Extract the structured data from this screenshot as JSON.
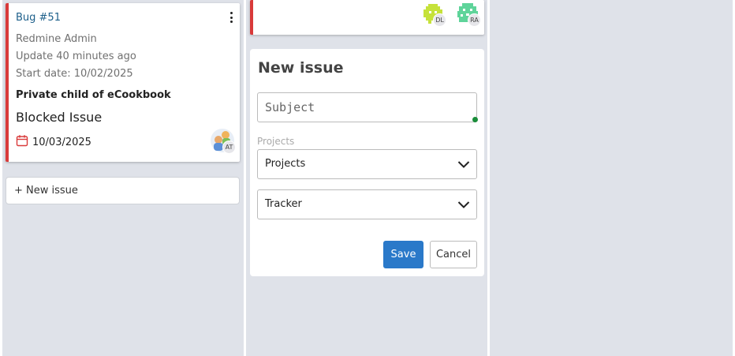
{
  "issue_card": {
    "title": "Bug #51",
    "author": "Redmine Admin",
    "updated": "Update 40 minutes ago",
    "start_date": "Start date: 10/02/2025",
    "project": "Private child of eCookbook",
    "subject": "Blocked Issue",
    "due_date": "10/03/2025",
    "assignee_initials": "AT",
    "accent_color": "#d93a3a"
  },
  "new_issue_link": "+ New issue",
  "top_card": {
    "avatars": [
      {
        "initials": "DL",
        "color": "#c6e23a"
      },
      {
        "initials": "RA",
        "color": "#5fd49a"
      }
    ]
  },
  "form": {
    "title": "New issue",
    "subject_placeholder": "Subject",
    "projects_label": "Projects",
    "projects_value": "Projects",
    "tracker_value": "Tracker",
    "save_label": "Save",
    "cancel_label": "Cancel"
  }
}
